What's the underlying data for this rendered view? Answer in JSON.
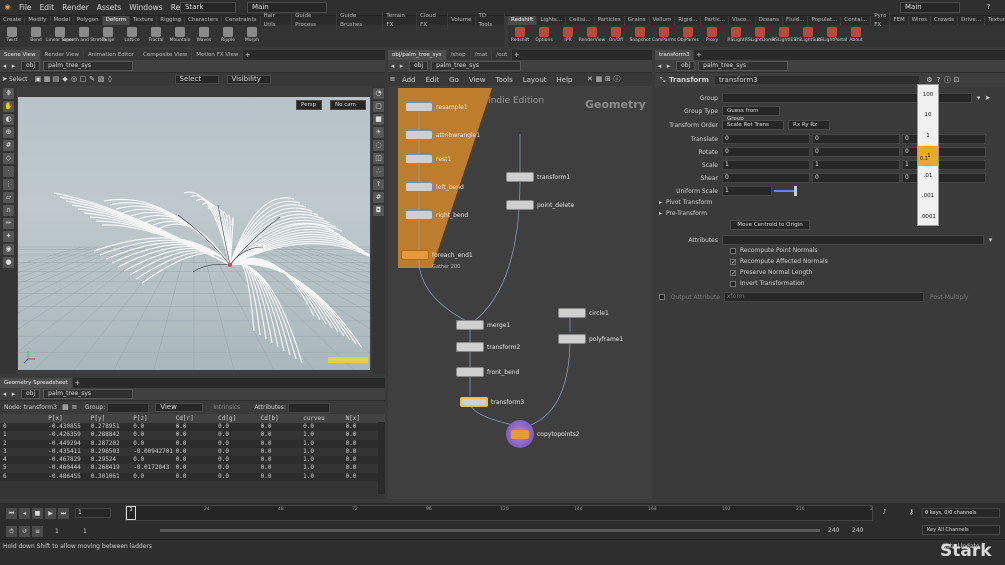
{
  "menubar": {
    "items": [
      "File",
      "Edit",
      "Render",
      "Assets",
      "Windows",
      "Redshift",
      "Help"
    ],
    "desktop": "Stark",
    "desktop_center": "Main",
    "desktop_right": "Main"
  },
  "shelf_left": {
    "tabs": [
      "Create",
      "Modify",
      "Model",
      "Polygon",
      "Deform",
      "Texture",
      "Rigging",
      "Characters",
      "Constraints",
      "Hair Utils",
      "Guide Process",
      "Guide Brushes",
      "Terrain FX",
      "Cloud FX",
      "Volume",
      "TD Tools"
    ],
    "active_tab": "Deform",
    "tools": [
      "Twist",
      "Bend",
      "Linear Taper",
      "Smooth and Stretch",
      "Bulge",
      "Lattice",
      "Fractal",
      "Mountain",
      "Waves",
      "Ripple",
      "Morph"
    ]
  },
  "shelf_right": {
    "tabs": [
      "Redshift",
      "Lights...",
      "Collisi...",
      "Particles",
      "Grains",
      "Vellum",
      "Rigid...",
      "Partic...",
      "Visco...",
      "Oceans",
      "Fluid...",
      "Populat...",
      "Contai...",
      "Pyro FX",
      "FEM",
      "Wires",
      "Crowds",
      "Drive...",
      "Texture"
    ],
    "active_tab": "Redshift",
    "tools": [
      "Redshift",
      "Options",
      "IPR",
      "RenderView",
      "On/Off",
      "Snapshot",
      "CamParms",
      "ObjParms",
      "Proxy",
      "RSLight",
      "RSLightDome",
      "RSLightIES",
      "RSLightSun",
      "RSLightPortal",
      "About"
    ]
  },
  "left_pane": {
    "tabs": [
      "Scene View",
      "Render View",
      "Animation Editor",
      "Composite View",
      "Motion FX View"
    ],
    "path_root": "obj",
    "path_node": "palm_tree_sys",
    "select_label": "Select",
    "select_mode": "Select",
    "visibility": "Visibility",
    "persp": "Persp",
    "cam": "No cam"
  },
  "spreadsheet": {
    "tabs": [
      "Geometry Spreadsheet"
    ],
    "path_root": "obj",
    "path_node": "palm_tree_sys",
    "node_label": "Node:",
    "node_value": "transform3",
    "group_label": "Group:",
    "view_label": "View",
    "intrinsics_label": "Intrinsics",
    "attributes_label": "Attributes:",
    "columns": [
      "",
      "P[x]",
      "P[y]",
      "P[z]",
      "Cd[r]",
      "Cd[g]",
      "Cd[b]",
      "curveu",
      "N[x]"
    ],
    "rows": [
      [
        "0",
        "-0.430855",
        "0.278951",
        "0.0",
        "0.0",
        "0.0",
        "0.0",
        "0.0",
        "0.0"
      ],
      [
        "1",
        "-0.426359",
        "0.288842",
        "0.0",
        "0.0",
        "0.0",
        "0.0",
        "1.0",
        "0.0"
      ],
      [
        "2",
        "-0.449294",
        "0.287202",
        "0.0",
        "0.0",
        "0.0",
        "0.0",
        "1.0",
        "0.0"
      ],
      [
        "3",
        "-0.435411",
        "0.296503",
        "-0.00942701",
        "0.0",
        "0.0",
        "0.0",
        "1.0",
        "0.0"
      ],
      [
        "4",
        "-0.467829",
        "0.29524",
        "0.0",
        "0.0",
        "0.0",
        "0.0",
        "1.0",
        "0.0"
      ],
      [
        "5",
        "-0.460444",
        "0.268419",
        "-0.0172043",
        "0.0",
        "0.0",
        "0.0",
        "1.0",
        "0.0"
      ],
      [
        "6",
        "-0.486455",
        "0.301061",
        "0.0",
        "0.0",
        "0.0",
        "0.0",
        "1.0",
        "0.0"
      ]
    ]
  },
  "network": {
    "tabs": [
      "obj/palm_tree_sys",
      "/shop",
      "/mat",
      "/out"
    ],
    "path_root": "obj",
    "path_node": "palm_tree_sys",
    "menu": [
      "Add",
      "Edit",
      "Go",
      "View",
      "Tools",
      "Layout",
      "Help"
    ],
    "watermark": "Indie Edition",
    "context_label": "Geometry",
    "nodes": {
      "resample1": "resample1",
      "attribwrangle1": "attribwrangle1",
      "rest1": "rest1",
      "left_bend": "left_bend",
      "right_bend": "right_bend",
      "foreach_end1": "foreach_end1",
      "gather": "Gather 200",
      "transform1": "transform1",
      "point_delete": "point_delete",
      "merge1": "merge1",
      "transform2": "transform2",
      "front_bend": "front_bend",
      "transform3": "transform3",
      "copytopoints2": "copytopoints2",
      "circle1": "circle1",
      "polyframe1": "polyframe1"
    }
  },
  "params": {
    "tab": "transform3",
    "node_type": "Transform",
    "node_name": "transform3",
    "group_label": "Group",
    "group_type_label": "Group Type",
    "group_type_value": "Guess from Group",
    "transform_order_label": "Transform Order",
    "transform_order_value": "Scale Rot Trans",
    "rot_order_value": "Rx Ry Rz",
    "translate_label": "Translate",
    "rotate_label": "Rotate",
    "scale_label": "Scale",
    "shear_label": "Shear",
    "uniform_scale_label": "Uniform Scale",
    "translate": [
      "0",
      "0",
      "0"
    ],
    "rotate": [
      "0",
      "0",
      "0"
    ],
    "scale": [
      "1",
      "1",
      "1"
    ],
    "shear": [
      "0",
      "0",
      "0"
    ],
    "uniform_scale": "1",
    "pivot_transform": "Pivot Transform",
    "pre_transform": "Pre-Transform",
    "move_centroid": "Move Centroid to Origin",
    "attributes_label": "Attributes",
    "recompute_point_normals": "Recompute Point Normals",
    "recompute_affected_normals": "Recompute Affected Normals",
    "preserve_normal_length": "Preserve Normal Length",
    "invert_transformation": "Invert Transformation",
    "output_attribute_label": "Output Attribute",
    "output_attribute_value": "xform",
    "post_multiply": "Post-Multiply",
    "ladder": [
      "100",
      "10",
      "1",
      ".1",
      ".01",
      ".001",
      ".0001"
    ],
    "ladder_active": ".1",
    "ladder_readout": "0.1"
  },
  "timeline": {
    "ticks": [
      "1",
      "24",
      "48",
      "72",
      "96",
      "120",
      "144",
      "168",
      "192",
      "216",
      "2"
    ],
    "current_frame": "1",
    "range_start": "1",
    "range_start2": "1",
    "range_end": "240",
    "range_end2": "240",
    "keys_label": "0 keys, 0/0 channels",
    "key_all": "Key All Channels",
    "auto_update": "Auto Update"
  },
  "status": {
    "message": "Hold down Shift to allow moving between ladders",
    "brand": "Stark"
  },
  "colors": {
    "accent": "#e8a92d",
    "foreach": "#d4882a",
    "selected_node": "#e6c93a",
    "copytopoints": "#8a64c8"
  }
}
